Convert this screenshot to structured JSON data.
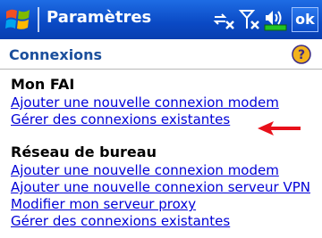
{
  "window": {
    "title": "Paramètres",
    "ok_label": "ok"
  },
  "page": {
    "title": "Connexions"
  },
  "sections": [
    {
      "heading": "Mon FAI",
      "links": [
        "Ajouter une nouvelle connexion modem",
        "Gérer des connexions existantes"
      ]
    },
    {
      "heading": "Réseau de bureau",
      "links": [
        "Ajouter une nouvelle connexion modem",
        "Ajouter une nouvelle connexion serveur VPN",
        "Modifier mon serveur proxy",
        "Gérer des connexions existantes"
      ]
    }
  ],
  "icons": {
    "start": "windows-flag-icon",
    "connectivity": "connectivity-off-icon",
    "signal": "no-signal-icon",
    "volume": "volume-icon",
    "help": "help-icon",
    "annotation": "red-arrow-icon"
  },
  "colors": {
    "titlebar": "#0a49c4",
    "page_title": "#1b4f9c",
    "link": "#0000d8",
    "help_badge": "#f2b21c",
    "arrow": "#e8101a"
  }
}
